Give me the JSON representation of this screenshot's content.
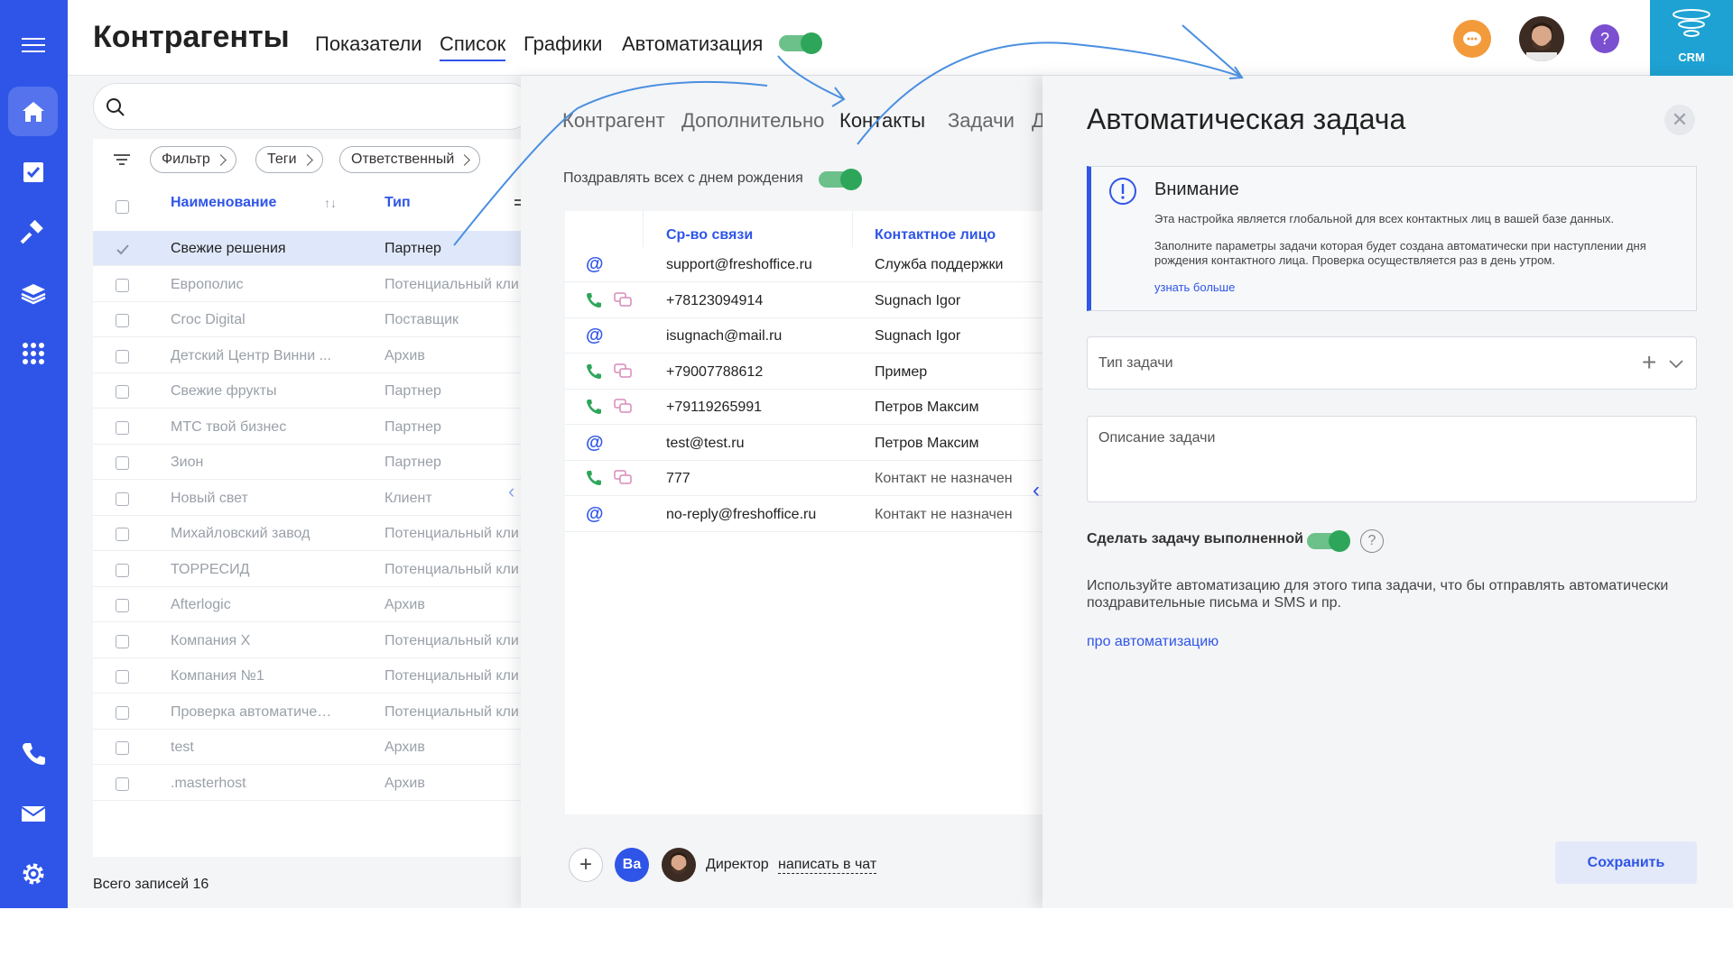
{
  "header": {
    "title": "Контрагенты",
    "tabs": [
      "Показатели",
      "Список",
      "Графики",
      "Автоматизация"
    ],
    "active_tab": "Список",
    "crm_label": "CRM"
  },
  "list": {
    "filters": [
      "Фильтр",
      "Теги",
      "Ответственный"
    ],
    "columns": {
      "name": "Наименование",
      "type": "Тип"
    },
    "rows": [
      {
        "name": "Свежие решения",
        "type": "Партнер"
      },
      {
        "name": "Европолис",
        "type": "Потенциальный кли"
      },
      {
        "name": "Croc Digital",
        "type": "Поставщик"
      },
      {
        "name": "Детский Центр Винни ...",
        "type": "Архив"
      },
      {
        "name": "Свежие фрукты",
        "type": "Партнер"
      },
      {
        "name": "МТС твой бизнес",
        "type": "Партнер"
      },
      {
        "name": "Зион",
        "type": "Партнер"
      },
      {
        "name": "Новый свет",
        "type": "Клиент"
      },
      {
        "name": "Михайловский завод",
        "type": "Потенциальный кли"
      },
      {
        "name": "ТОРРЕСИД",
        "type": "Потенциальный кли"
      },
      {
        "name": "Afterlogic",
        "type": "Архив"
      },
      {
        "name": "Компания X",
        "type": "Потенциальный кли"
      },
      {
        "name": "Компания №1",
        "type": "Потенциальный кли"
      },
      {
        "name": "Проверка автоматичес...",
        "type": "Потенциальный кли"
      },
      {
        "name": "test",
        "type": "Архив"
      },
      {
        "name": ".masterhost",
        "type": "Архив"
      }
    ],
    "total": "Всего записей 16"
  },
  "contact": {
    "tabs": [
      "Контрагент",
      "Дополнительно",
      "Контакты",
      "Задачи",
      "Д"
    ],
    "active_tab": "Контакты",
    "birthday_label": "Поздравлять всех с днем рождения",
    "columns": {
      "channel": "Ср-во связи",
      "person": "Контактное лицо"
    },
    "rows": [
      {
        "kind": "email",
        "value": "support@freshoffice.ru",
        "person": "Служба поддержки"
      },
      {
        "kind": "phone",
        "value": "+78123094914",
        "person": "Sugnach Igor"
      },
      {
        "kind": "email",
        "value": "isugnach@mail.ru",
        "person": "Sugnach Igor"
      },
      {
        "kind": "phone",
        "value": "+79007788612",
        "person": "Пример"
      },
      {
        "kind": "phone",
        "value": "+79119265991",
        "person": "Петров Максим"
      },
      {
        "kind": "email",
        "value": "test@test.ru",
        "person": "Петров Максим"
      },
      {
        "kind": "phone",
        "value": "777",
        "person": "Контакт не назначен"
      },
      {
        "kind": "email",
        "value": "no-reply@freshoffice.ru",
        "person": "Контакт не назначен"
      }
    ],
    "footer": {
      "initials": "Ва",
      "role": "Директор",
      "chat_link": "написать в чат"
    }
  },
  "auto_task": {
    "title": "Автоматическая задача",
    "notice": {
      "title": "Внимание",
      "text1": "Эта настройка является глобальной для всех контактных лиц в вашей базе данных.",
      "text2": "Заполните параметры задачи которая будет создана автоматически при наступлении дня рождения контактного лица. Проверка осуществляется раз в день утром.",
      "link": "узнать больше"
    },
    "task_type_placeholder": "Тип задачи",
    "description_placeholder": "Описание задачи",
    "done_label": "Сделать задачу выполненной",
    "help_symbol": "?",
    "description": "Используйте автоматизацию для этого типа задачи, что бы отправлять автоматически поздравительные письма и SMS и пр.",
    "link": "про автоматизацию",
    "save_label": "Сохранить"
  },
  "colors": {
    "accent": "#2f55e8",
    "toggle_on": "#2ea65a",
    "crm_tile": "#1ea2d3",
    "notify": "#f39a3b",
    "help": "#7a4fd0"
  }
}
